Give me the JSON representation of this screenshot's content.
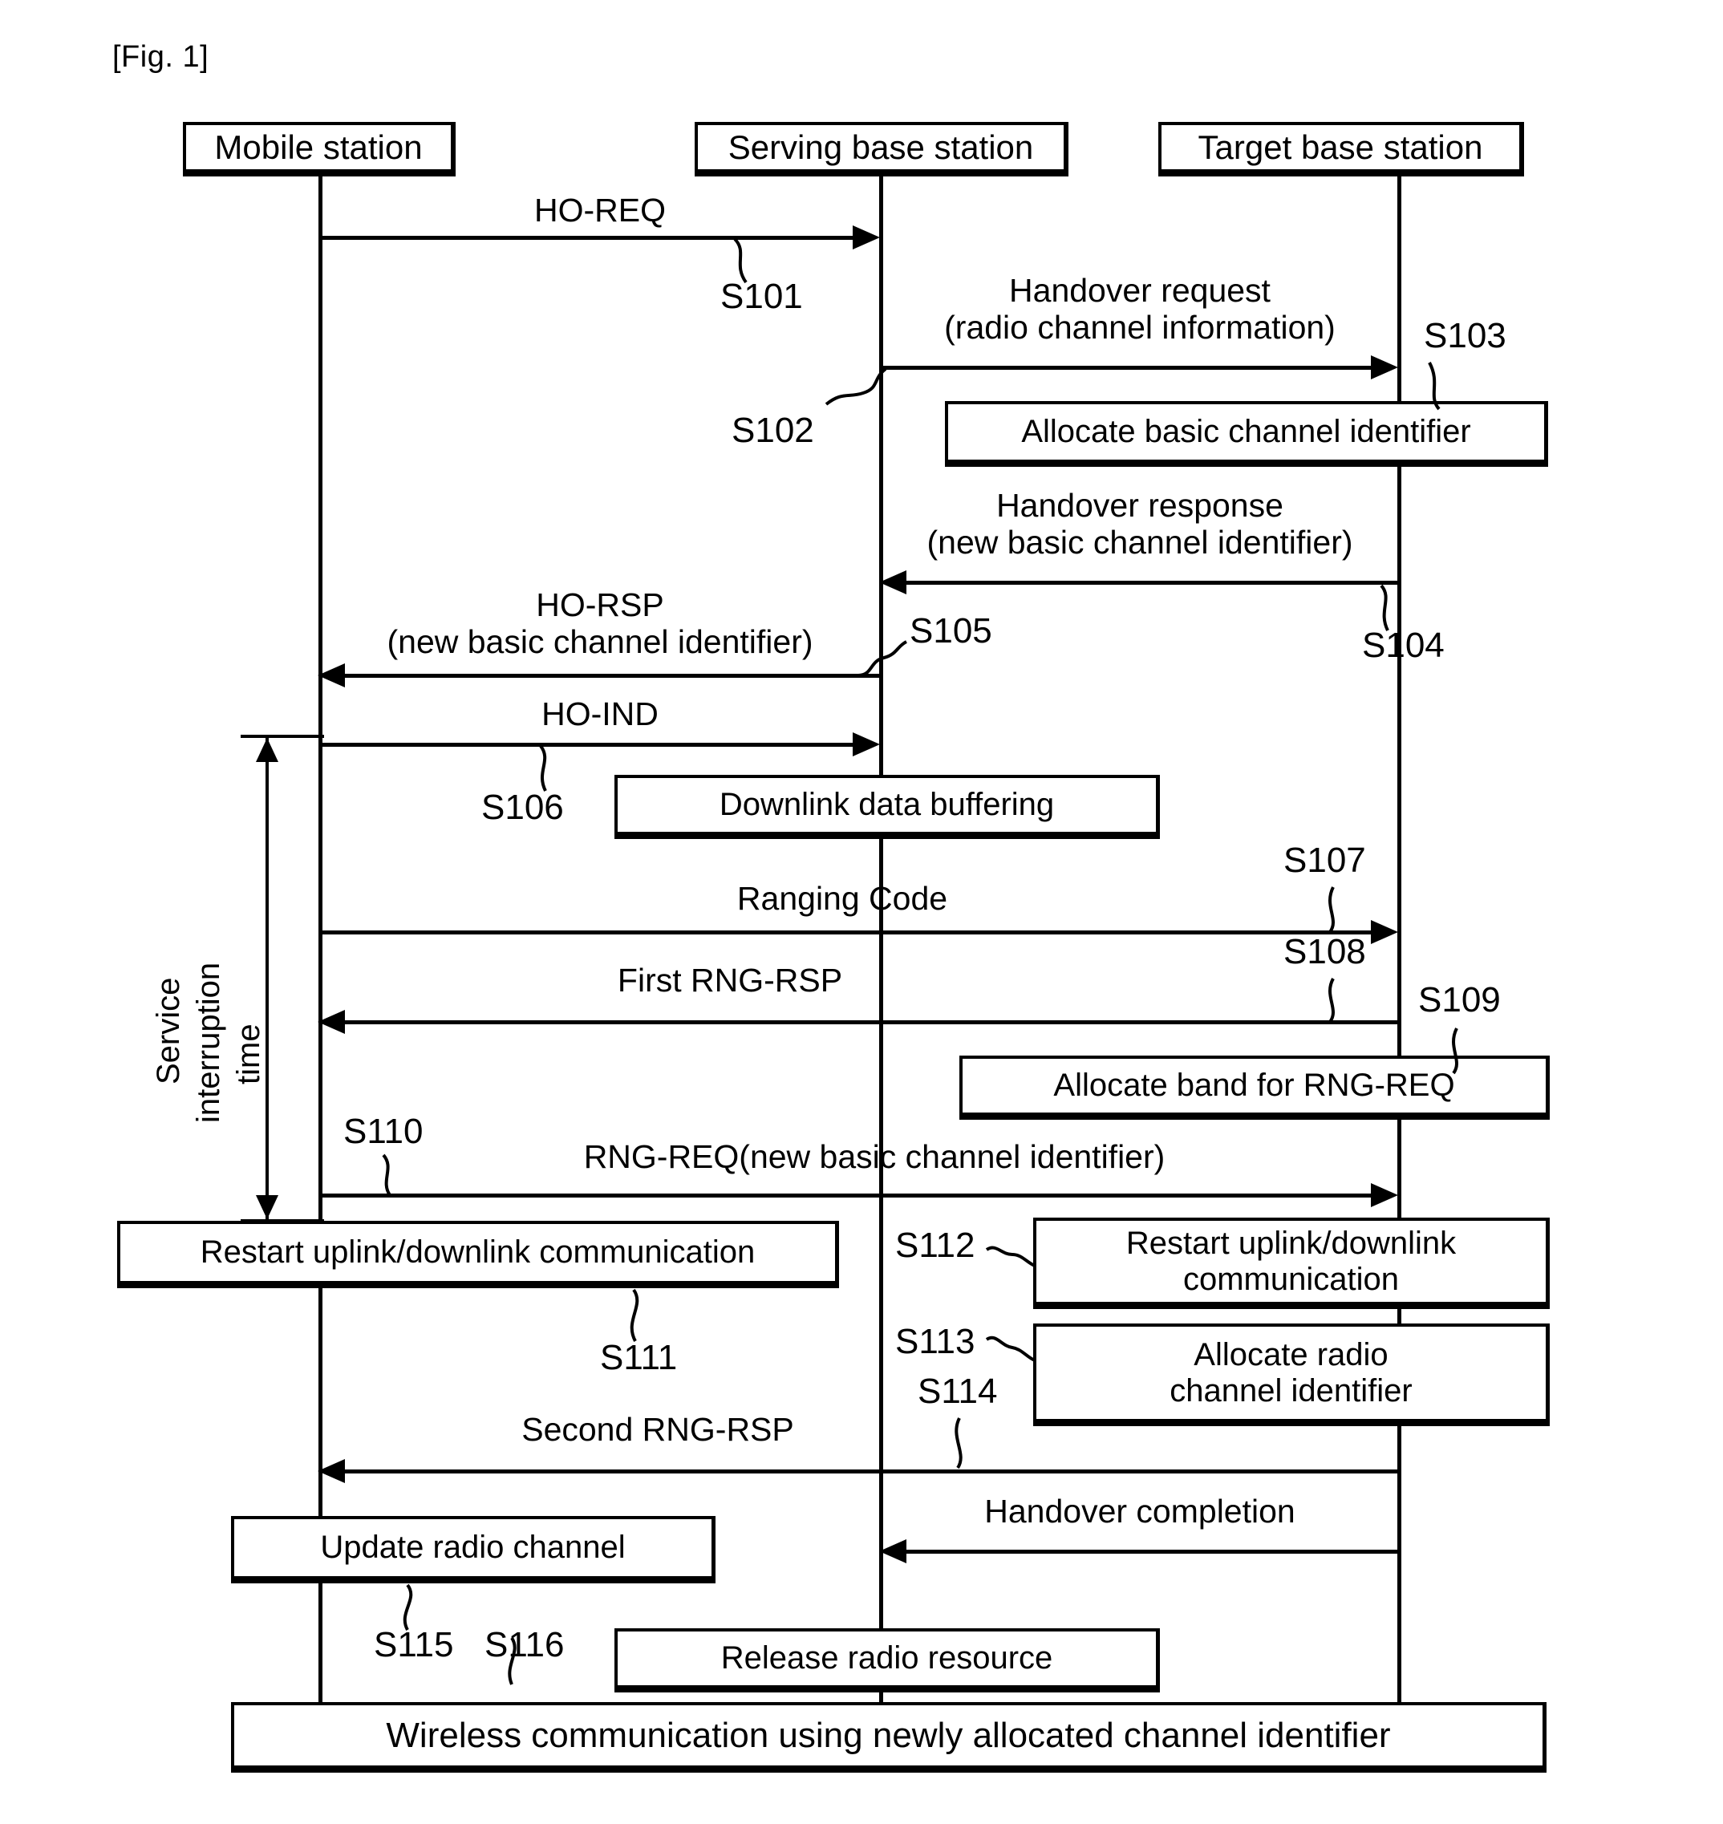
{
  "figure": {
    "label": "[Fig. 1]",
    "type": "sequence-diagram"
  },
  "actors": [
    {
      "id": "ms",
      "label": "Mobile station"
    },
    {
      "id": "sbs",
      "label": "Serving base station"
    },
    {
      "id": "tbs",
      "label": "Target base station"
    }
  ],
  "annotations": {
    "service_interruption": {
      "line1": "Service",
      "line2": "interruption",
      "line3": "time"
    }
  },
  "messages": [
    {
      "id": "m101",
      "text": "HO-REQ",
      "from": "ms",
      "to": "sbs",
      "step": "S101"
    },
    {
      "id": "m102",
      "text": "Handover request\n(radio channel information)",
      "from": "sbs",
      "to": "tbs",
      "step": "S102",
      "step2": "S103"
    },
    {
      "id": "m104",
      "text": "Handover response\n(new basic channel identifier)",
      "from": "tbs",
      "to": "sbs",
      "step": "S104"
    },
    {
      "id": "m105",
      "text": "HO-RSP\n(new basic channel identifier)",
      "from": "sbs",
      "to": "ms",
      "step": "S105"
    },
    {
      "id": "m106",
      "text": "HO-IND",
      "from": "ms",
      "to": "sbs",
      "step": "S106"
    },
    {
      "id": "m107",
      "text": "Ranging Code",
      "from": "ms",
      "to": "tbs",
      "step": "S107"
    },
    {
      "id": "m108",
      "text": "First RNG-RSP",
      "from": "tbs",
      "to": "ms",
      "step": "S108",
      "step2": "S109"
    },
    {
      "id": "m110",
      "text": "RNG-REQ(new basic channel identifier)",
      "from": "ms",
      "to": "tbs",
      "step": "S110"
    },
    {
      "id": "m114",
      "text": "Second RNG-RSP",
      "from": "tbs",
      "to": "ms",
      "step": "S114"
    },
    {
      "id": "m115",
      "text": "Handover completion",
      "from": "tbs",
      "to": "sbs",
      "step": ""
    }
  ],
  "processes": [
    {
      "id": "p103",
      "text": "Allocate basic channel identifier",
      "step": "S103"
    },
    {
      "id": "p106",
      "text": "Downlink data buffering",
      "step": ""
    },
    {
      "id": "p109",
      "text": "Allocate band for RNG-REQ",
      "step": "S109"
    },
    {
      "id": "p111",
      "text": "Restart uplink/downlink communication",
      "step": "S111"
    },
    {
      "id": "p112",
      "text": "Restart uplink/downlink\ncommunication",
      "step": "S112"
    },
    {
      "id": "p113",
      "text": "Allocate radio\nchannel identifier",
      "step": "S113"
    },
    {
      "id": "p115",
      "text": "Update radio channel",
      "step": "S115"
    },
    {
      "id": "p116",
      "text": "Release radio resource",
      "step": "S116"
    },
    {
      "id": "p117",
      "text": "Wireless communication using newly allocated channel identifier",
      "step": ""
    }
  ],
  "steps": {
    "s101": "S101",
    "s102": "S102",
    "s103": "S103",
    "s104": "S104",
    "s105": "S105",
    "s106": "S106",
    "s107": "S107",
    "s108": "S108",
    "s109": "S109",
    "s110": "S110",
    "s111": "S111",
    "s112": "S112",
    "s113": "S113",
    "s114": "S114",
    "s115": "S115",
    "s116": "S116"
  },
  "colors": {
    "ink": "#000000",
    "paper": "#ffffff"
  }
}
